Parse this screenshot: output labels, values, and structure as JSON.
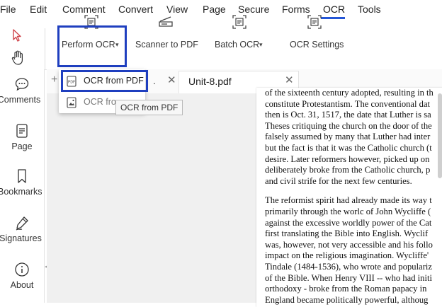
{
  "menu": {
    "items": [
      "File",
      "Edit",
      "Comment",
      "Convert",
      "View",
      "Page",
      "Secure",
      "Forms",
      "OCR",
      "Tools"
    ]
  },
  "toolbar": {
    "perform_ocr": "Perform OCR",
    "scanner_to_pdf": "Scanner to PDF",
    "batch_ocr": "Batch OCR",
    "ocr_settings": "OCR Settings"
  },
  "sidebar": {
    "items": [
      "Comments",
      "Page",
      "Bookmarks",
      "Signatures",
      "About"
    ]
  },
  "tabs": {
    "first_tab_partial": ".",
    "active_tab": "Unit-8.pdf"
  },
  "dropdown": {
    "item1": "OCR from PDF",
    "item2": "OCR from"
  },
  "tooltip": "OCR from PDF",
  "document": {
    "lines_para1": [
      "of the sixteenth century adopted, resulting in th",
      "constitute Protestantism. The conventional dat",
      "then is Oct. 31, 1517, the date that Luther is sa",
      "Theses critiquing the church on the door of the",
      "falsely assumed by many that Luther had inter",
      "but the fact is that it was the Catholic church (t",
      "desire. Later reformers however, picked up on",
      "deliberately broke from the Catholic church, p",
      "and civil strife for the next few centuries."
    ],
    "lines_para2": [
      "The reformist spirit had already made its way t",
      "primarily through the worlc of John Wycliffe (",
      "against the excessive worldly power of the Cat",
      "first translating the Bible into English. Wyclif",
      "was, however, not very accessible and his follo",
      "impact on the religious imagination. Wycliffe'",
      "Tindale (1484-1536), who wrote and populariz",
      "of the Bible. When Henry VIII -- who had initi",
      "orthodoxy - broke from the Roman papacy in",
      "England became politically powerful, althoug"
    ]
  },
  "colors": {
    "highlight": "#1f3fbf",
    "accent": "#2456d6"
  }
}
